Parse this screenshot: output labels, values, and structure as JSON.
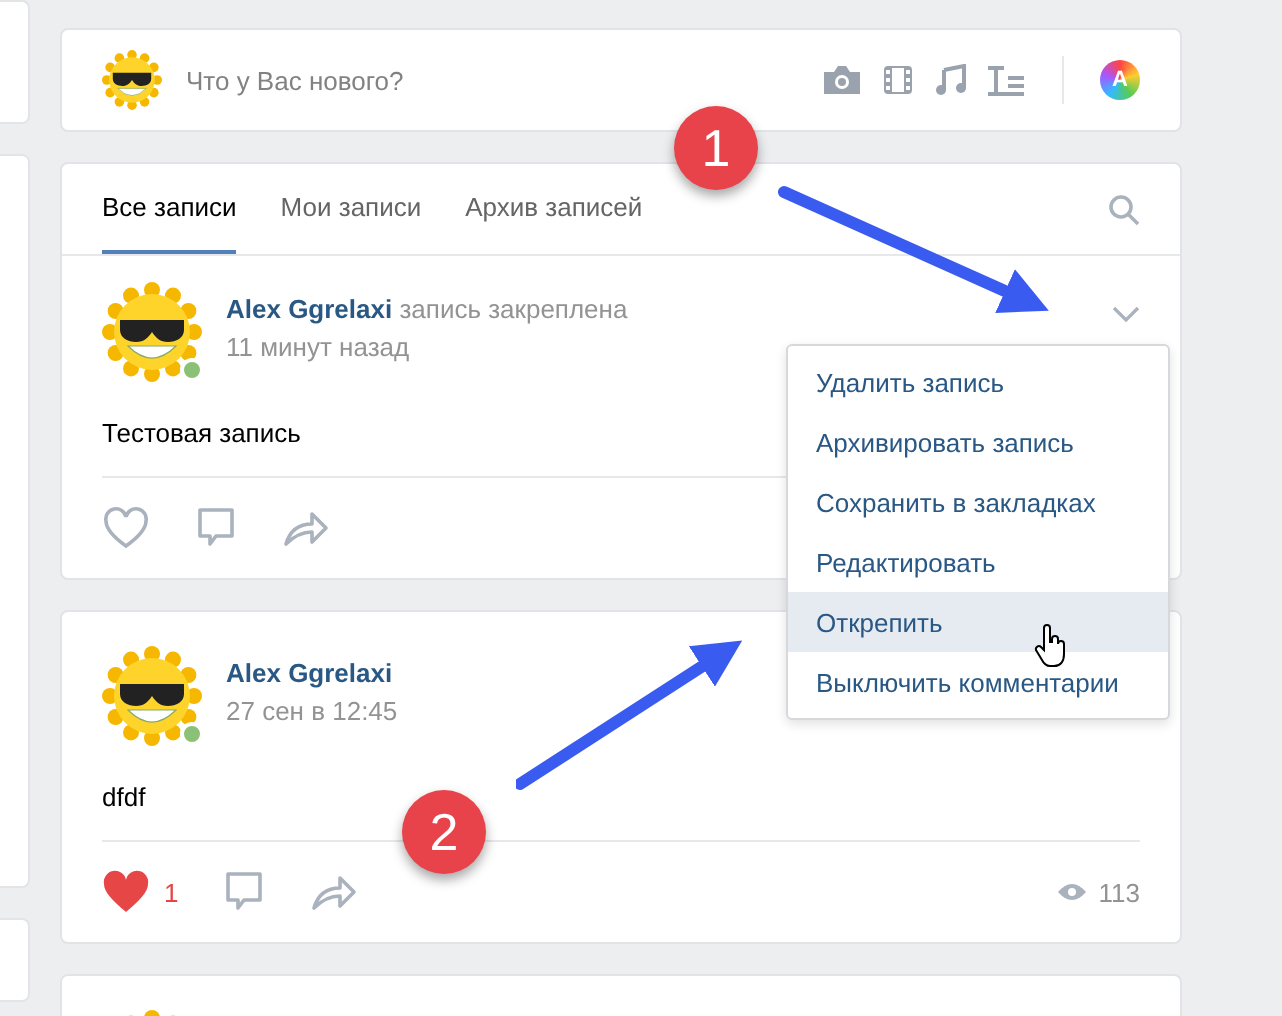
{
  "composer": {
    "placeholder": "Что у Вас нового?",
    "badge": "A"
  },
  "tabs": [
    {
      "label": "Все записи",
      "selected": true
    },
    {
      "label": "Мои записи",
      "selected": false
    },
    {
      "label": "Архив записей",
      "selected": false
    }
  ],
  "posts": [
    {
      "author": "Alex Ggrelaxi",
      "action": "запись закреплена",
      "time": "11 минут назад",
      "text": "Тестовая запись",
      "online": true,
      "liked": false,
      "menu": {
        "items": [
          {
            "label": "Удалить запись",
            "selected": false
          },
          {
            "label": "Архивировать запись",
            "selected": false
          },
          {
            "label": "Сохранить в закладках",
            "selected": false
          },
          {
            "label": "Редактировать",
            "selected": false
          },
          {
            "label": "Открепить",
            "selected": true
          },
          {
            "label": "Выключить комментарии",
            "selected": false
          }
        ]
      }
    },
    {
      "author": "Alex Ggrelaxi",
      "time": "27 сен в 12:45",
      "text": "dfdf",
      "online": true,
      "liked": true,
      "likes": "1",
      "views": "113"
    }
  ],
  "annotations": [
    {
      "label": "1"
    },
    {
      "label": "2"
    }
  ]
}
